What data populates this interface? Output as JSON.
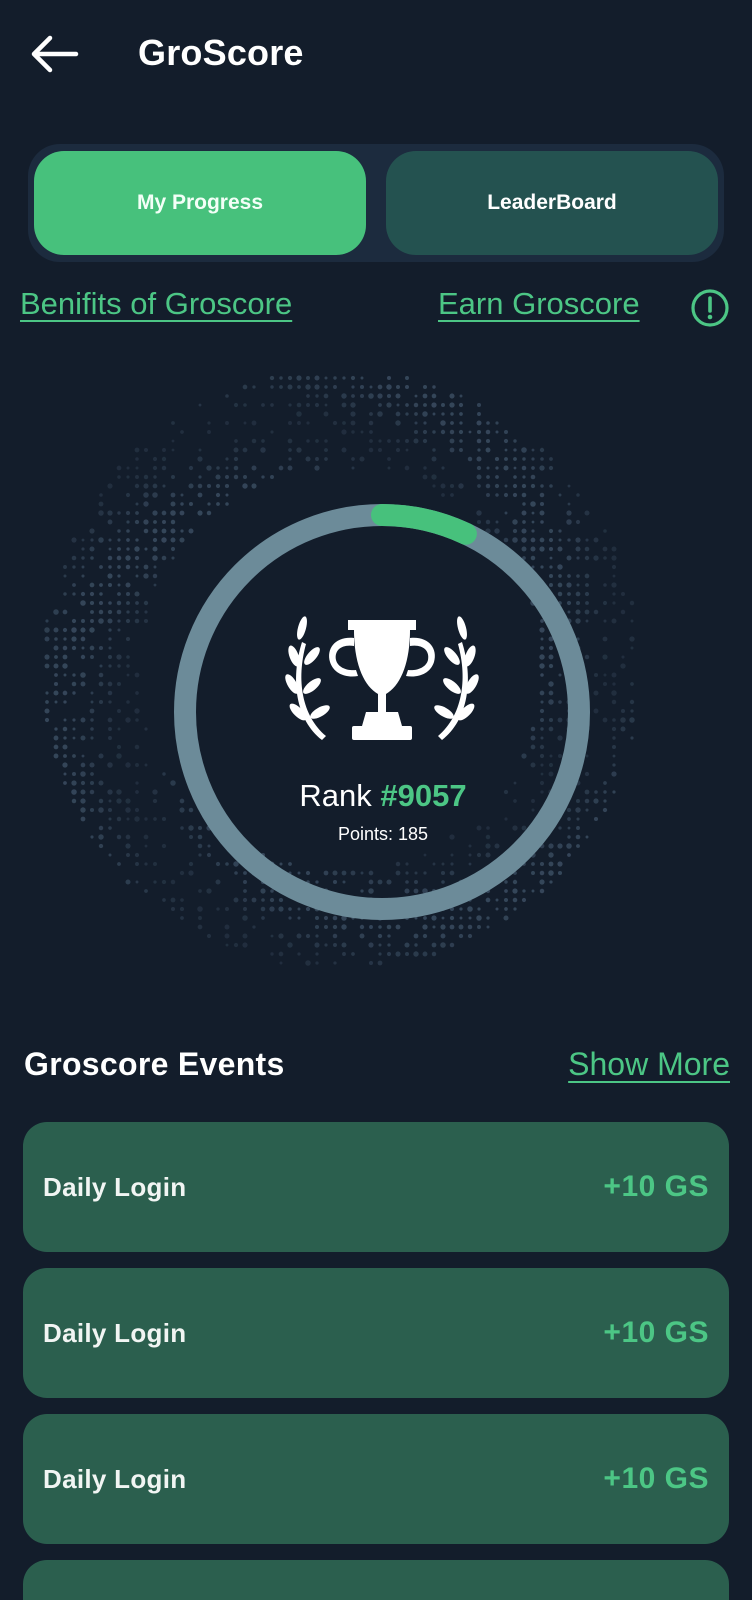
{
  "header": {
    "title": "GroScore",
    "back_icon": "arrow-left-icon"
  },
  "tabs": [
    {
      "label": "My Progress",
      "active": true
    },
    {
      "label": "LeaderBoard",
      "active": false
    }
  ],
  "links": {
    "benefits": "Benifits of Groscore",
    "earn": "Earn Groscore",
    "info_icon": "info-circle-icon"
  },
  "rank": {
    "label": "Rank",
    "number": "#9057",
    "points_text": "Points: 185",
    "progress_fraction": 0.07,
    "icon": "trophy-laurel-icon"
  },
  "events": {
    "title": "Groscore Events",
    "show_more": "Show More",
    "items": [
      {
        "name": "Daily Login",
        "points": "+10 GS"
      },
      {
        "name": "Daily Login",
        "points": "+10 GS"
      },
      {
        "name": "Daily Login",
        "points": "+10 GS"
      }
    ]
  },
  "colors": {
    "background": "#131d2b",
    "accent": "#47c17c",
    "accent_text": "#4cc685",
    "card": "#2b5f4e",
    "tab_inactive": "#245250",
    "ring_track": "#6c8b99"
  }
}
